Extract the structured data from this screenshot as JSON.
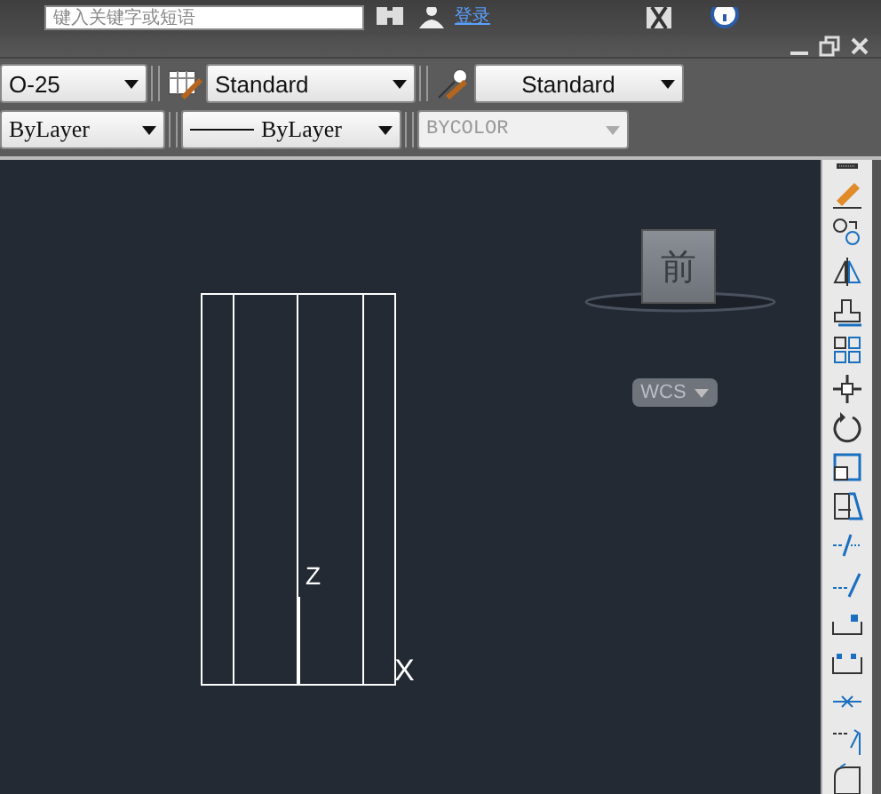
{
  "search": {
    "placeholder": "键入关键字或短语"
  },
  "sign_in": {
    "label": "登录"
  },
  "toolbar_rows": [
    [
      {
        "kind": "dropdown",
        "value": "O-25",
        "disabled": false
      },
      {
        "kind": "table-style",
        "value": "Standard",
        "disabled": false
      },
      {
        "kind": "leader-style",
        "value": "Standard",
        "disabled": false
      }
    ],
    [
      {
        "kind": "dropdown",
        "value": "ByLayer",
        "disabled": false
      },
      {
        "kind": "linetype",
        "value": "ByLayer",
        "disabled": false
      },
      {
        "kind": "dropdown",
        "value": "BYCOLOR",
        "disabled": true
      }
    ]
  ],
  "viewcube": {
    "face": "前",
    "coordinate_system": "WCS"
  },
  "ucs_icon": {
    "z_label": "Z",
    "x_label": "X"
  }
}
